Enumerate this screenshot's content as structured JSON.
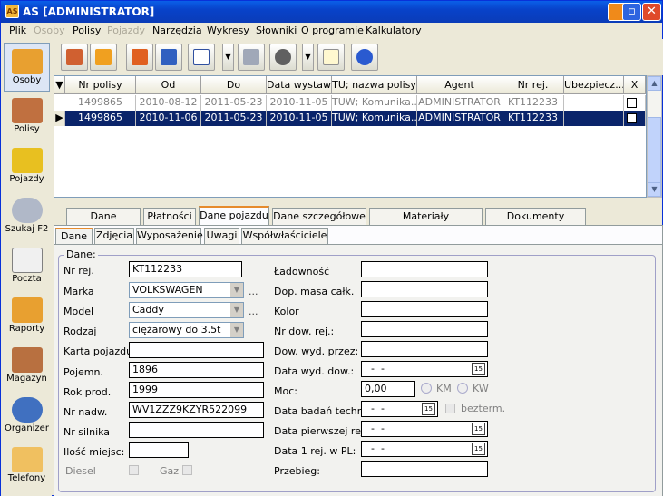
{
  "window": {
    "title": "AS [ADMINISTRATOR]",
    "app_icon_text": "AS"
  },
  "menu": [
    "Plik",
    "Osoby",
    "Polisy",
    "Pojazdy",
    "Narzędzia",
    "Wykresy",
    "Słowniki",
    "O programie",
    "Kalkulatory"
  ],
  "menu_disabled": [
    "Osoby",
    "Pojazdy"
  ],
  "sidebar": [
    {
      "label": "Osoby",
      "icon": "people-icon"
    },
    {
      "label": "Polisy",
      "icon": "folders-icon"
    },
    {
      "label": "Pojazdy",
      "icon": "truck-icon"
    },
    {
      "label": "Szukaj F2",
      "icon": "magnifier-icon"
    },
    {
      "label": "Poczta",
      "icon": "mail-icon"
    },
    {
      "label": "Raporty",
      "icon": "pencil-icon"
    },
    {
      "label": "Magazyn",
      "icon": "box-icon"
    },
    {
      "label": "Organizer",
      "icon": "clock-icon"
    },
    {
      "label": "Telefony",
      "icon": "phone-icon"
    }
  ],
  "toolbar": [
    "filter-icon",
    "refresh-icon",
    "eraser-icon",
    "checkbox-icon",
    "sort-az-icon",
    "print-icon",
    "check-icon",
    "new-document-icon",
    "help-icon"
  ],
  "grid": {
    "columns": [
      "Nr polisy",
      "Od",
      "Do",
      "Data wystaw.",
      "TU; nazwa polisy",
      "Agent",
      "Nr rej.",
      "Ubezpiecz...",
      "X"
    ],
    "rows": [
      [
        "1499865",
        "2010-08-12",
        "2011-05-23",
        "2010-11-05",
        "TUW; Komunika...",
        "ADMINISTRATOR",
        "KT112233",
        ""
      ],
      [
        "1499865",
        "2010-11-06",
        "2011-05-23",
        "2010-11-05",
        "TUW; Komunika...",
        "ADMINISTRATOR",
        "KT112233",
        ""
      ]
    ]
  },
  "tabs": [
    "Dane osobowe",
    "Płatności",
    "Dane pojazdu",
    "Dane szczegółowe",
    "Materiały zeskanowane",
    "Dokumenty tekstowe"
  ],
  "active_tab": "Dane pojazdu",
  "subtabs": [
    "Dane",
    "Zdjęcia",
    "Wyposażenie",
    "Uwagi",
    "Współwłaściciele"
  ],
  "active_subtab": "Dane",
  "form": {
    "group_label": "Dane:",
    "nr_rej": {
      "label": "Nr rej.",
      "value": "KT112233"
    },
    "marka": {
      "label": "Marka",
      "value": "VOLKSWAGEN"
    },
    "model": {
      "label": "Model",
      "value": "Caddy"
    },
    "rodzaj": {
      "label": "Rodzaj",
      "value": "ciężarowy do 3.5t"
    },
    "karta": {
      "label": "Karta pojazdu:",
      "value": ""
    },
    "pojemn": {
      "label": "Pojemn.",
      "value": "1896"
    },
    "rok": {
      "label": "Rok prod.",
      "value": "1999"
    },
    "nadw": {
      "label": "Nr nadw.",
      "value": "WV1ZZZ9KZYR522099"
    },
    "silnika": {
      "label": "Nr silnika",
      "value": ""
    },
    "miejsc": {
      "label": "Ilość miejsc:",
      "value": ""
    },
    "diesel": "Diesel",
    "gaz": "Gaz",
    "ladownosc": {
      "label": "Ładowność",
      "value": ""
    },
    "dmc": {
      "label": "Dop. masa całk.",
      "value": ""
    },
    "kolor": {
      "label": "Kolor",
      "value": ""
    },
    "nr_dow": {
      "label": "Nr dow. rej.:",
      "value": ""
    },
    "dow_przez": {
      "label": "Dow. wyd. przez:",
      "value": ""
    },
    "data_dow": {
      "label": "Data wyd. dow.:",
      "value": "  -  -"
    },
    "moc": {
      "label": "Moc:",
      "value": "0,00",
      "km": "KM",
      "kw": "KW"
    },
    "badan": {
      "label": "Data badań techn.:",
      "value": "  -  -",
      "bezterm": "bezterm."
    },
    "pierwszej": {
      "label": "Data pierwszej rej.:",
      "value": "  -  -"
    },
    "pl": {
      "label": "Data 1 rej. w PL:",
      "value": "  -  -"
    },
    "przebieg": {
      "label": "Przebieg:",
      "value": ""
    },
    "ellipsis": "...",
    "cal_text": "15"
  }
}
